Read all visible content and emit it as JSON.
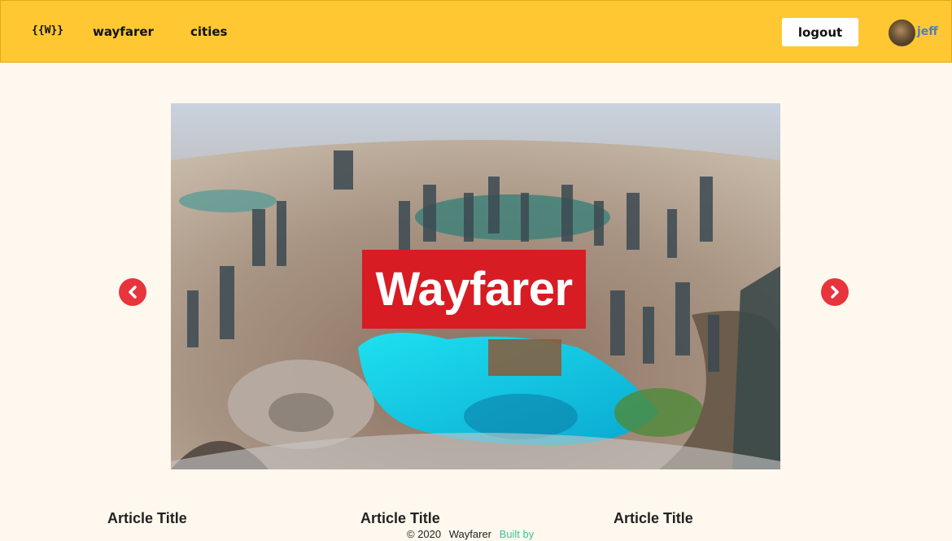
{
  "navbar": {
    "logo": "{{W}}",
    "links": [
      "wayfarer",
      "cities"
    ],
    "logout_label": "logout",
    "username": "jeff"
  },
  "hero": {
    "title": "Wayfarer"
  },
  "articles": [
    {
      "title": "Article Title"
    },
    {
      "title": "Article Title"
    },
    {
      "title": "Article Title"
    }
  ],
  "footer": {
    "copyright": "© 2020",
    "brand": "Wayfarer",
    "built_by": "Built by"
  },
  "colors": {
    "navbar": "#ffc832",
    "background": "#fff8ee",
    "hero_title_bg": "#d71c24",
    "arrow": "#e8343c",
    "username": "#4a7fc1",
    "built_by": "#3fbfa0"
  }
}
